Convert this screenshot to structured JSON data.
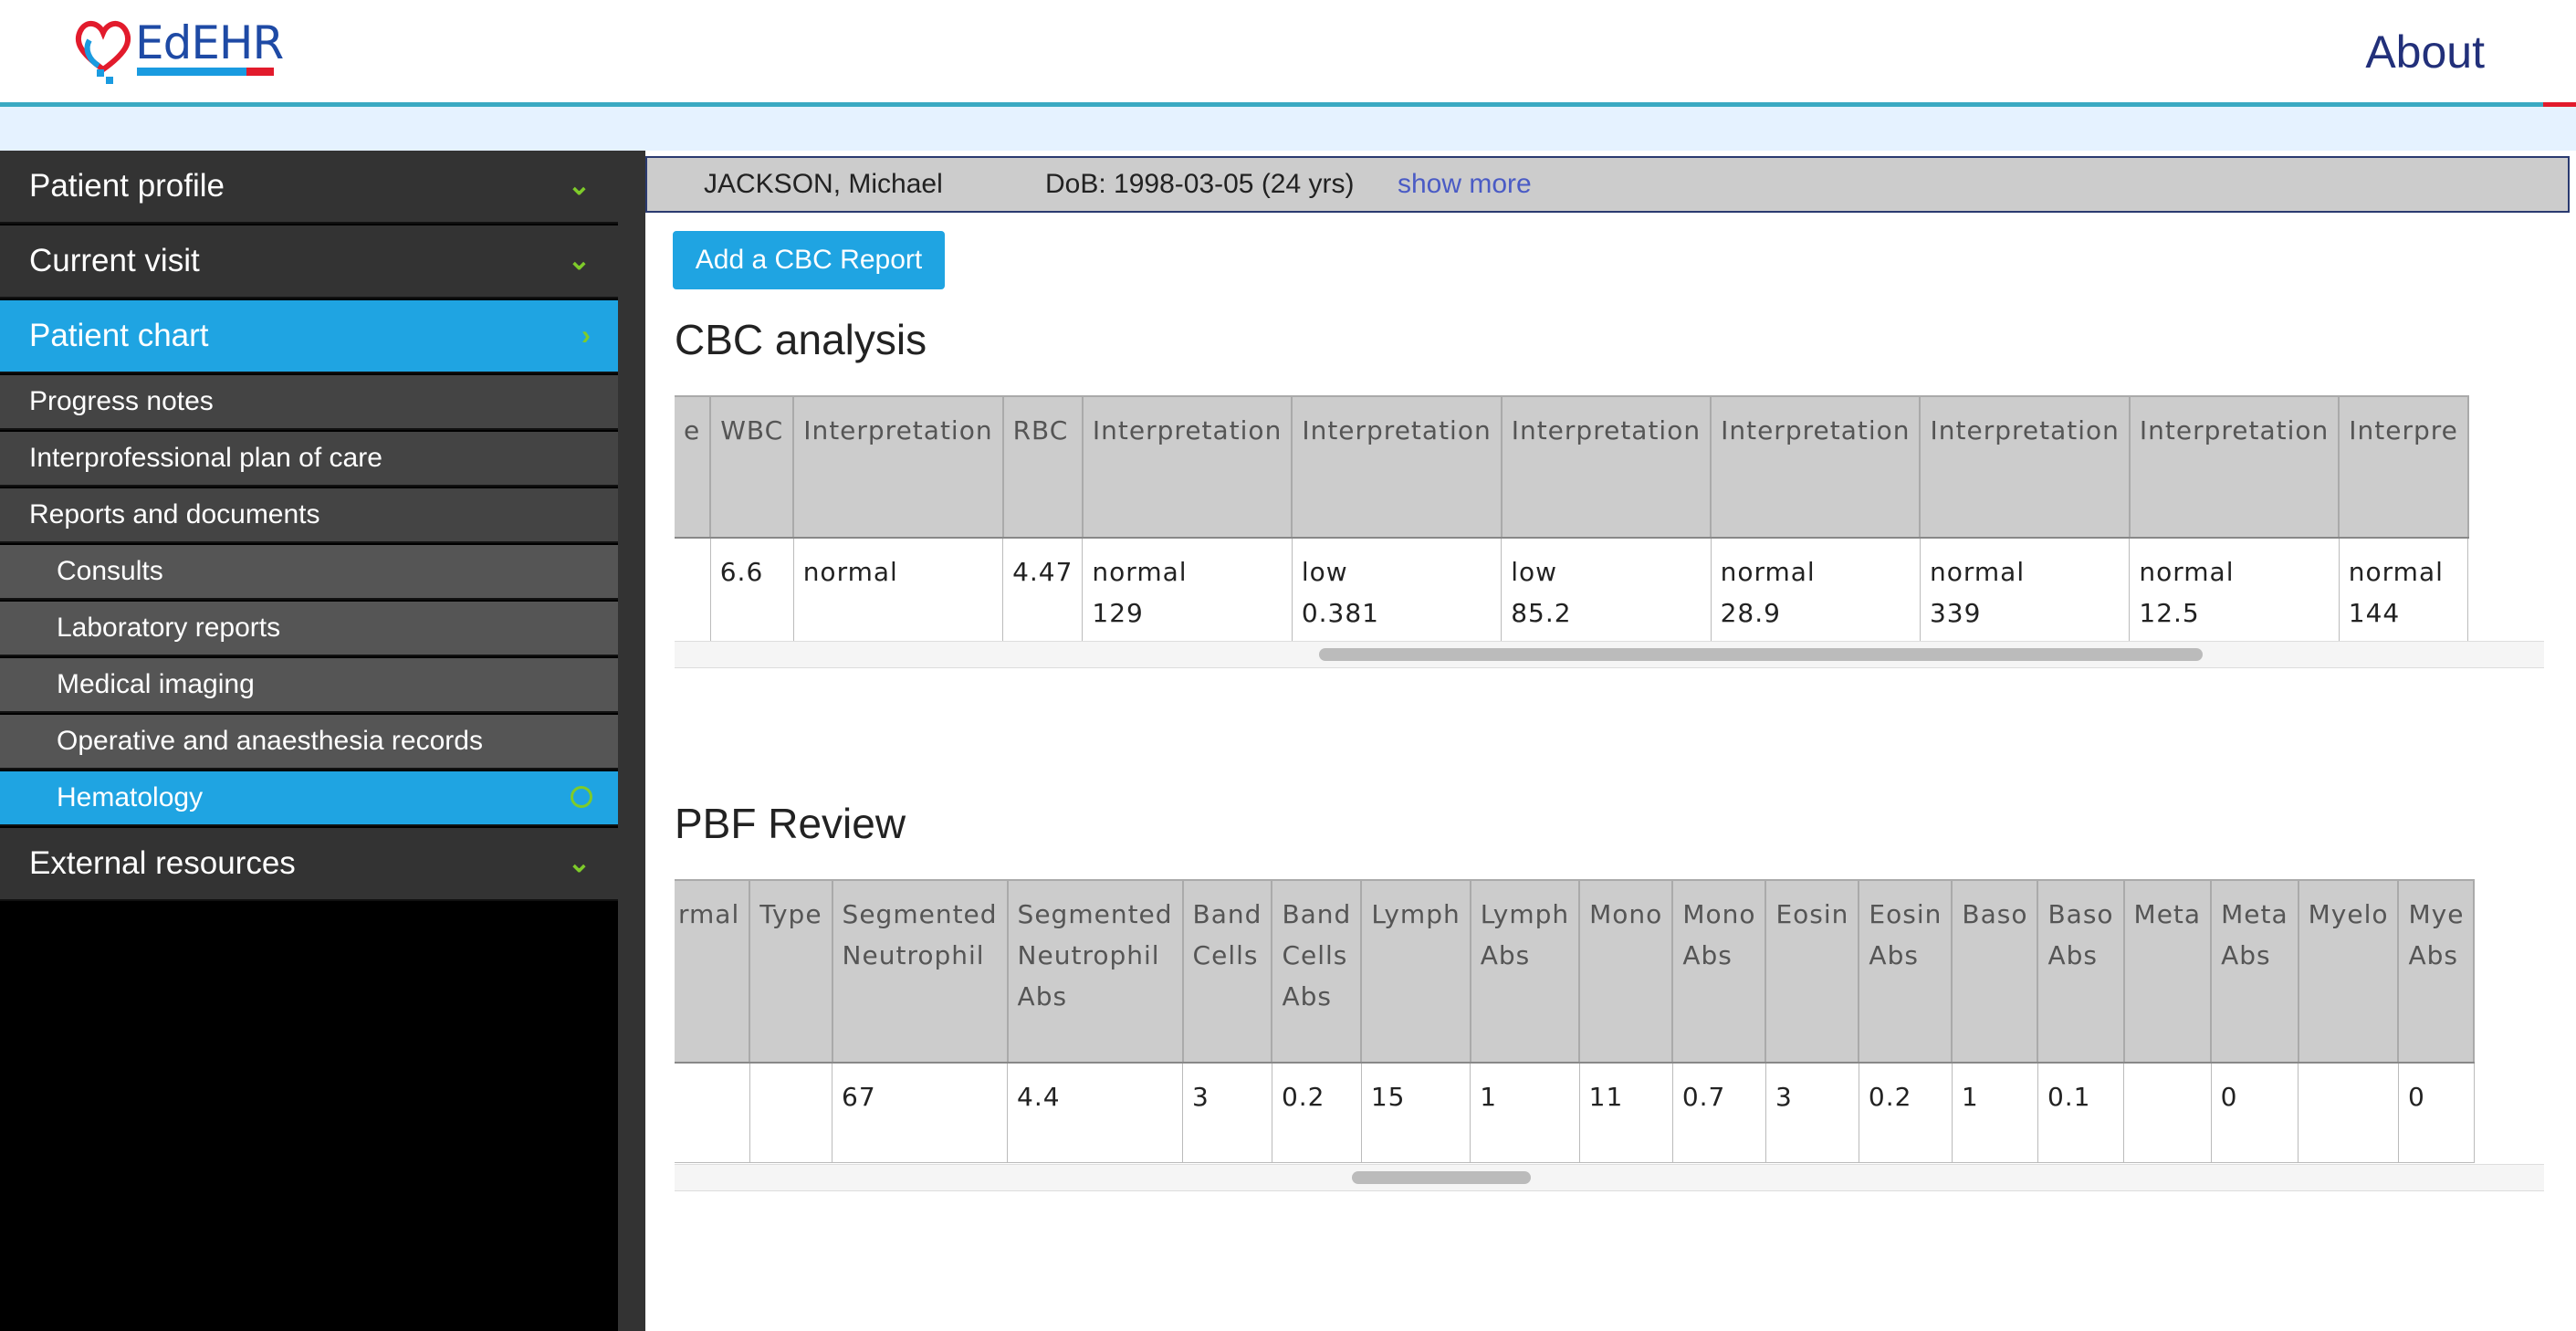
{
  "header": {
    "logo_text": "EdEHR",
    "about_label": "About"
  },
  "sidebar": {
    "top_items": [
      {
        "label": "Patient profile",
        "chevron": "v"
      },
      {
        "label": "Current visit",
        "chevron": "v"
      },
      {
        "label": "Patient chart",
        "chevron": ">"
      }
    ],
    "chart_items": [
      "Progress notes",
      "Interprofessional plan of care",
      "Reports and documents"
    ],
    "report_items": [
      "Consults",
      "Laboratory reports",
      "Medical imaging",
      "Operative and anaesthesia records",
      "Hematology"
    ],
    "bottom_item": {
      "label": "External resources",
      "chevron": "v"
    }
  },
  "patient": {
    "name": "JACKSON, Michael",
    "dob": "DoB: 1998-03-05 (24 yrs)",
    "show_more": "show more"
  },
  "add_button": "Add a CBC Report",
  "cbc": {
    "title": "CBC analysis",
    "headers": [
      "e",
      "WBC",
      "Interpretation",
      "RBC",
      "Interpretation",
      "Interpretation",
      "Interpretation",
      "Interpretation",
      "Interpretation",
      "Interpretation",
      "Interpre"
    ],
    "row": [
      "",
      "6.6",
      "normal",
      "4.47",
      "normal\n129",
      "low\n0.381",
      "low\n85.2",
      "normal\n28.9",
      "normal\n339",
      "normal\n12.5",
      "normal\n144"
    ]
  },
  "pbf": {
    "title": "PBF Review",
    "headers": [
      "rmal",
      "Type",
      "Segmented\nNeutrophil",
      "Segmented\nNeutrophil\nAbs",
      "Band\nCells",
      "Band\nCells\nAbs",
      "Lymph",
      "Lymph\nAbs",
      "Mono",
      "Mono\nAbs",
      "Eosin",
      "Eosin\nAbs",
      "Baso",
      "Baso\nAbs",
      "Meta",
      "Meta\nAbs",
      "Myelo",
      "Mye\nAbs"
    ],
    "row": [
      "",
      "",
      "67",
      "4.4",
      "3",
      "0.2",
      "15",
      "1",
      "11",
      "0.7",
      "3",
      "0.2",
      "1",
      "0.1",
      "",
      "0",
      "",
      "0"
    ]
  }
}
